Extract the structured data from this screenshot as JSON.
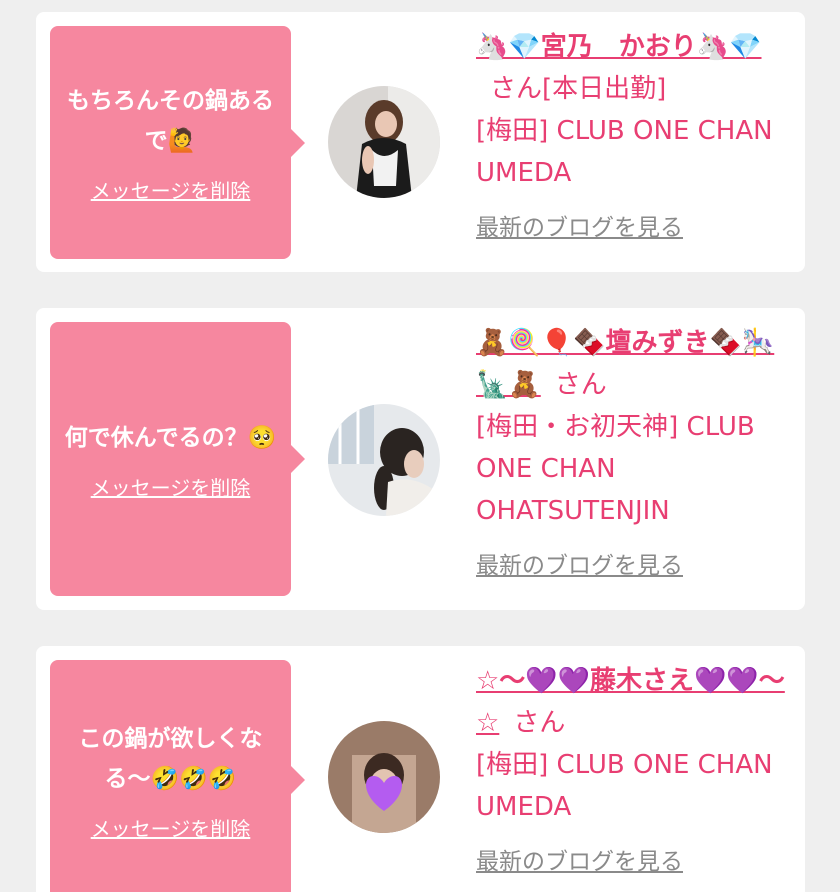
{
  "messages": [
    {
      "text": "もちろんその鍋あるで🙋",
      "delete_label": "メッセージを削除",
      "cast_name": "🦄💎宮乃　かおり🦄💎",
      "honorific": "さん[本日出勤]",
      "shop": "[梅田] CLUB ONE CHAN UMEDA",
      "blog_label": "最新のブログを見る"
    },
    {
      "text": "何で休んでるの？🥺",
      "delete_label": "メッセージを削除",
      "cast_name": "🧸🍭🎈🍫壇みずき🍫🎠🗽🧸",
      "honorific": "さん",
      "shop": "[梅田・お初天神] CLUB ONE CHAN OHATSUTENJIN",
      "blog_label": "最新のブログを見る"
    },
    {
      "text": "この鍋が欲しくなる〜🤣🤣🤣",
      "delete_label": "メッセージを削除",
      "cast_name": "☆〜💜💜藤木さえ💜💜〜☆",
      "honorific": "さん",
      "shop": "[梅田] CLUB ONE CHAN UMEDA",
      "blog_label": "最新のブログを見る"
    }
  ]
}
